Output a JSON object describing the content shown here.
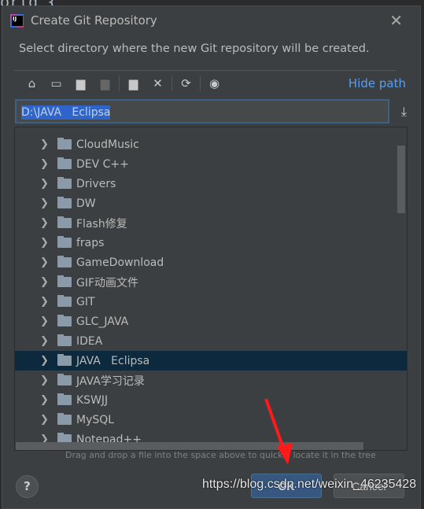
{
  "background_code": "orld {",
  "dialog": {
    "title": "Create Git Repository",
    "description": "Select directory where the new Git repository will be created.",
    "toolbar": {
      "icons": [
        "home-icon",
        "desktop-icon",
        "project-folder-icon",
        "module-folder-icon",
        "new-folder-icon",
        "delete-icon",
        "refresh-icon",
        "show-hidden-icon"
      ],
      "hide_path": "Hide path"
    },
    "path_value": "D:\\JAVA   Eclipsa",
    "tree": {
      "items": [
        "CloudMusic",
        "DEV C++",
        "Drivers",
        "DW",
        "Flash修复",
        "fraps",
        "GameDownload",
        "GIF动画文件",
        "GIT",
        "GLC_JAVA",
        "IDEA",
        "JAVA   Eclipsa",
        "JAVA学习记录",
        "KSWJJ",
        "MySQL",
        "Notepad++"
      ],
      "selected": "JAVA   Eclipsa"
    },
    "hint": "Drag and drop a file into the space above to quickly locate it in the tree",
    "help": "?",
    "ok": "OK",
    "cancel": "Cancel"
  },
  "watermark": "https://blog.csdn.net/weixin_46235428",
  "colors": {
    "accent": "#589df6",
    "selection": "#0d293e",
    "ok_button": "#365880",
    "annotation_arrow": "#ff1a1a"
  }
}
